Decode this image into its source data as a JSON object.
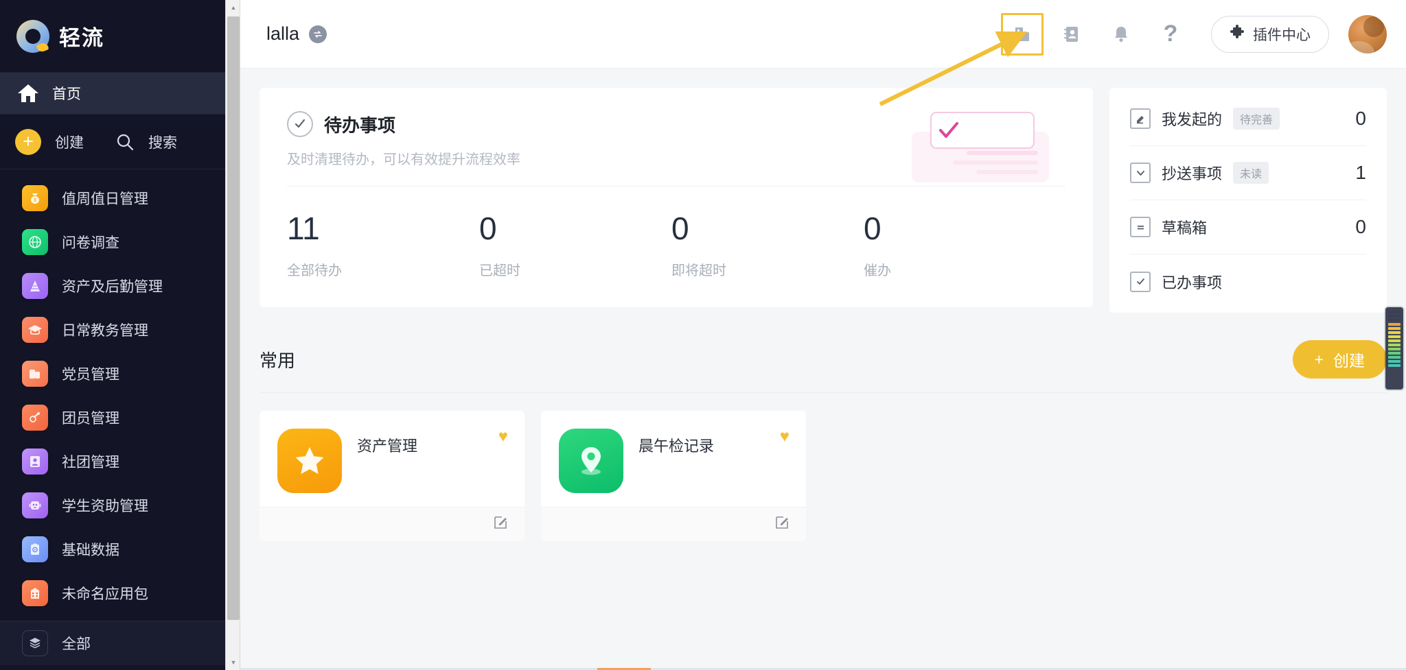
{
  "sidebar": {
    "brand": {
      "name": "轻流",
      "logo_icon": "q-logo-icon"
    },
    "home": {
      "label": "首页",
      "icon": "home-icon"
    },
    "actions": {
      "create_label": "创建",
      "create_icon": "plus-circle-icon",
      "search_label": "搜索",
      "search_icon": "search-icon"
    },
    "apps": [
      {
        "label": "值周值日管理",
        "icon": "money-bag-icon",
        "color": "#f6b21b",
        "glyph": "💰"
      },
      {
        "label": "问卷调查",
        "icon": "globe-icon",
        "color": "#1ed178",
        "glyph": "🌐"
      },
      {
        "label": "资产及后勤管理",
        "icon": "cone-icon",
        "color": "#a470f5",
        "glyph": "▲"
      },
      {
        "label": "日常教务管理",
        "icon": "graduation-cap-icon",
        "color": "#f77b5c",
        "glyph": "🎓"
      },
      {
        "label": "党员管理",
        "icon": "mobile-bag-icon",
        "color": "#f98a62",
        "glyph": "📱"
      },
      {
        "label": "团员管理",
        "icon": "robot-arm-icon",
        "color": "#f7744f",
        "glyph": "🤖"
      },
      {
        "label": "社团管理",
        "icon": "id-card-icon",
        "color": "#b07df7",
        "glyph": "👤"
      },
      {
        "label": "学生资助管理",
        "icon": "robot-face-icon",
        "color": "#b07df7",
        "glyph": "🤖"
      },
      {
        "label": "基础数据",
        "icon": "clipboard-icon",
        "color": "#7ea2f8",
        "glyph": "📋"
      },
      {
        "label": "未命名应用包",
        "icon": "building-icon",
        "color": "#f7784f",
        "glyph": "🏢"
      }
    ],
    "all": {
      "label": "全部",
      "icon": "layers-icon"
    }
  },
  "topbar": {
    "workspace_title": "lalla",
    "switch_icon": "switch-workspace-icon",
    "icons": [
      {
        "name": "organization-icon",
        "highlighted": true
      },
      {
        "name": "address-book-icon",
        "highlighted": false
      },
      {
        "name": "bell-icon",
        "highlighted": false
      },
      {
        "name": "help-question-icon",
        "highlighted": false
      }
    ],
    "plugin_button": {
      "label": "插件中心",
      "icon": "puzzle-icon"
    },
    "avatar_name": "user-avatar"
  },
  "todo_card": {
    "icon": "check-circle-icon",
    "title": "待办事项",
    "subtitle": "及时清理待办，可以有效提升流程效率",
    "stats": [
      {
        "value": "11",
        "caption": "全部待办"
      },
      {
        "value": "0",
        "caption": "已超时"
      },
      {
        "value": "0",
        "caption": "即将超时"
      },
      {
        "value": "0",
        "caption": "催办"
      }
    ]
  },
  "side_card": {
    "rows": [
      {
        "icon": "compose-icon",
        "label": "我发起的",
        "tag": "待完善",
        "count": "0"
      },
      {
        "icon": "inbox-cc-icon",
        "label": "抄送事项",
        "tag": "未读",
        "count": "1"
      },
      {
        "icon": "draft-icon",
        "label": "草稿箱",
        "tag": "",
        "count": "0"
      },
      {
        "icon": "done-check-icon",
        "label": "已办事项",
        "tag": "",
        "count": ""
      }
    ]
  },
  "favorites": {
    "section_title": "常用",
    "create_button": {
      "label": "创建",
      "icon": "plus-icon"
    },
    "cards": [
      {
        "name": "资产管理",
        "icon": "star-icon",
        "color_from": "#fbb615",
        "color_to": "#f79a0a",
        "favorite_icon": "heart-icon",
        "edit_icon": "edit-icon"
      },
      {
        "name": "晨午检记录",
        "icon": "location-pin-icon",
        "color_from": "#2ed77e",
        "color_to": "#0dbd6a",
        "favorite_icon": "heart-icon",
        "edit_icon": "edit-icon"
      }
    ]
  },
  "colors": {
    "sidebar_bg": "#131526",
    "accent_yellow": "#f0bf31",
    "page_bg": "#f5f6f7",
    "highlight_border": "#f2c037"
  },
  "meter": {
    "name": "level-meter-widget",
    "segments": [
      "#3a4052",
      "#3a4052",
      "#3a4052",
      "#e8a33d",
      "#f0c038",
      "#efd23c",
      "#e3dc44",
      "#c9dd4c",
      "#a8d95a",
      "#86d46c",
      "#66ce7e",
      "#54c896",
      "#4ec5a8",
      "#4bc2b4"
    ]
  },
  "bottom_strip": {
    "name": "page-load-progress"
  }
}
